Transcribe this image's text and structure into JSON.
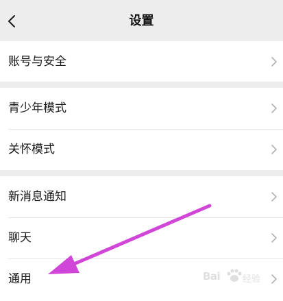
{
  "header": {
    "title": "设置",
    "back_icon": "chevron-left-icon"
  },
  "groups": [
    {
      "items": [
        {
          "label": "账号与安全",
          "icon": "chevron-right-icon"
        }
      ]
    },
    {
      "items": [
        {
          "label": "青少年模式",
          "icon": "chevron-right-icon"
        },
        {
          "label": "关怀模式",
          "icon": "chevron-right-icon"
        }
      ]
    },
    {
      "items": [
        {
          "label": "新消息通知",
          "icon": "chevron-right-icon"
        },
        {
          "label": "聊天",
          "icon": "chevron-right-icon"
        },
        {
          "label": "通用",
          "icon": "chevron-right-icon"
        }
      ]
    }
  ],
  "annotation": {
    "arrow_color": "#d046d6",
    "target": "通用"
  },
  "watermark": {
    "brand": "Bai",
    "suffix": "经验"
  },
  "colors": {
    "background": "#ededed",
    "row_background": "#ffffff",
    "text": "#1a1a1a",
    "chevron": "#b2b2b2"
  }
}
